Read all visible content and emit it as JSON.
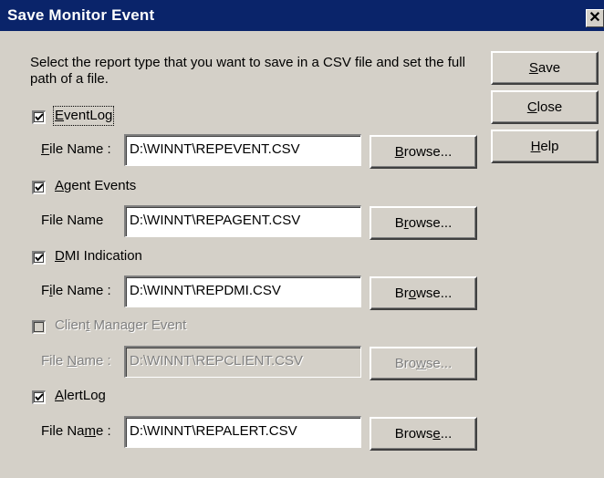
{
  "window": {
    "title": "Save Monitor Event",
    "close_glyph": "✕"
  },
  "description": "Select the report type that you want to save in a CSV file and set the full path of a file.",
  "side_buttons": [
    {
      "pre": "",
      "mn": "S",
      "post": "ave"
    },
    {
      "pre": "",
      "mn": "C",
      "post": "lose"
    },
    {
      "pre": "",
      "mn": "H",
      "post": "elp"
    }
  ],
  "sections": [
    {
      "checked": true,
      "enabled": true,
      "checkbox": {
        "pre": "",
        "mn": "E",
        "post": "ventLog"
      },
      "field_label": {
        "pre": "",
        "mn": "F",
        "post": "ile Name :"
      },
      "path": "D:\\WINNT\\REPEVENT.CSV",
      "browse": {
        "pre": "",
        "mn": "B",
        "post": "rowse..."
      }
    },
    {
      "checked": true,
      "enabled": true,
      "checkbox": {
        "pre": "",
        "mn": "A",
        "post": "gent Events"
      },
      "field_label": {
        "pre": "File Name",
        "mn": "",
        "post": ""
      },
      "path": "D:\\WINNT\\REPAGENT.CSV",
      "browse": {
        "pre": "B",
        "mn": "r",
        "post": "owse..."
      }
    },
    {
      "checked": true,
      "enabled": true,
      "checkbox": {
        "pre": "",
        "mn": "D",
        "post": "MI Indication"
      },
      "field_label": {
        "pre": "F",
        "mn": "i",
        "post": "le Name :"
      },
      "path": "D:\\WINNT\\REPDMI.CSV",
      "browse": {
        "pre": "Br",
        "mn": "o",
        "post": "wse..."
      }
    },
    {
      "checked": false,
      "enabled": false,
      "checkbox": {
        "pre": "Clien",
        "mn": "t",
        "post": " Manager Event"
      },
      "field_label": {
        "pre": "File ",
        "mn": "N",
        "post": "ame :"
      },
      "path": "D:\\WINNT\\REPCLIENT.CSV",
      "browse": {
        "pre": "Bro",
        "mn": "w",
        "post": "se..."
      }
    },
    {
      "checked": true,
      "enabled": true,
      "checkbox": {
        "pre": "",
        "mn": "A",
        "post": "lertLog"
      },
      "field_label": {
        "pre": "File Na",
        "mn": "m",
        "post": "e :"
      },
      "path": "D:\\WINNT\\REPALERT.CSV",
      "browse": {
        "pre": "Brows",
        "mn": "e",
        "post": "..."
      }
    }
  ],
  "colors": {
    "titlebar": "#0a246a",
    "face": "#d4d0c8",
    "disabled_text": "#808080"
  }
}
